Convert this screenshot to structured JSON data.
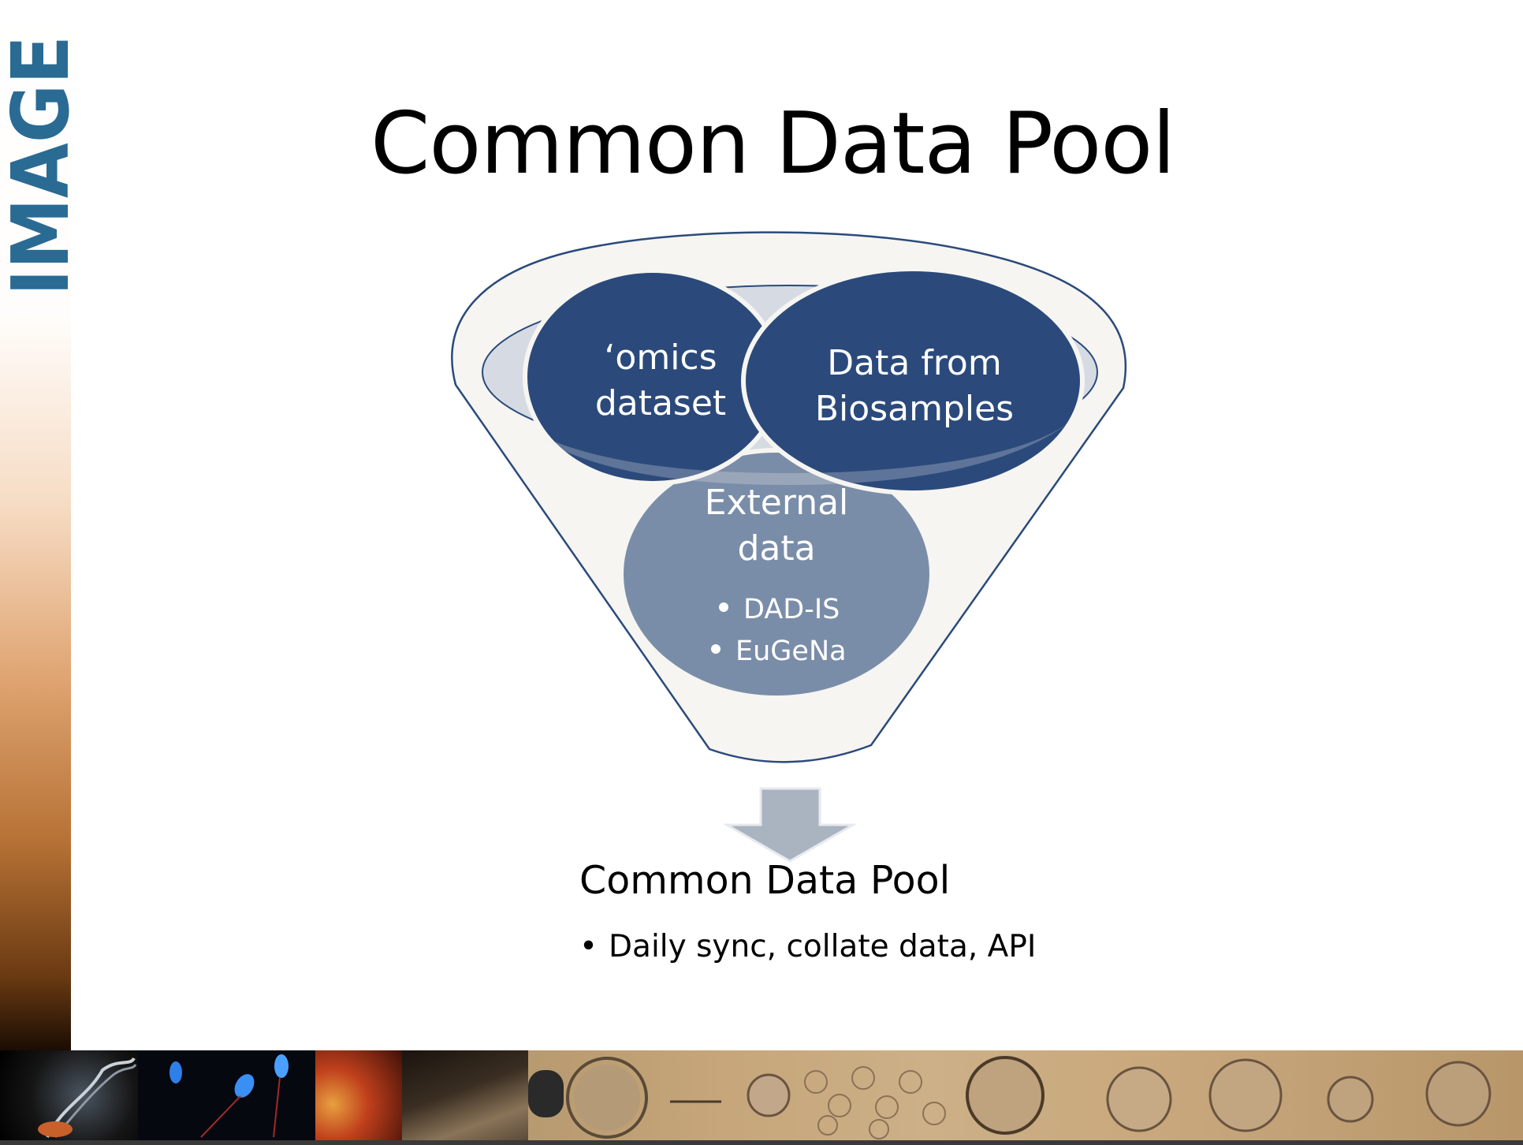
{
  "slide": {
    "logo_text": "IMAGE",
    "title": "Common Data Pool"
  },
  "funnel": {
    "omics_label": [
      "‘omics",
      "dataset"
    ],
    "biosamples_label": [
      "Data from",
      "Biosamples"
    ],
    "external_label": [
      "External",
      "data"
    ],
    "external_items": [
      "DAD-IS",
      "EuGeNa"
    ]
  },
  "output": {
    "heading": "Common Data Pool",
    "bullets": [
      "Daily sync, collate data, API"
    ]
  },
  "colors": {
    "logo": "#2a6b94",
    "dark_circle": "#2b4a7b",
    "light_circle": "#7a8da8",
    "funnel_fill": "#f6f5f1",
    "funnel_stroke": "#2b4a7b",
    "arrow": "#aab3c0"
  }
}
